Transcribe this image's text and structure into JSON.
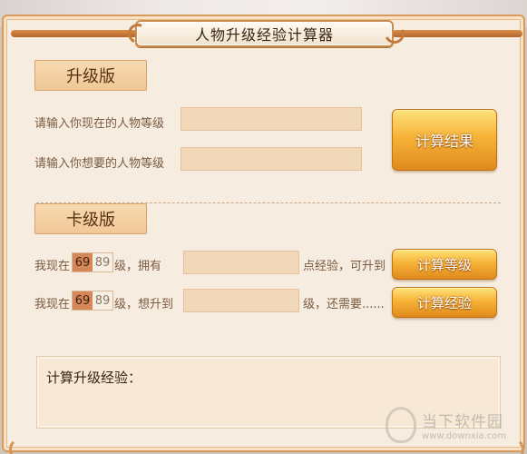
{
  "window": {
    "title": "人物升级经验计算器"
  },
  "upgrade": {
    "section_label": "升级版",
    "current_level_label": "请输入你现在的人物等级",
    "target_level_label": "请输入你想要的人物等级",
    "current_level_value": "",
    "target_level_value": "",
    "compute_button": "计算结果"
  },
  "card": {
    "section_label": "卡级版",
    "row1": {
      "prefix": "我现在",
      "current_level": "69",
      "max_level": "89",
      "suffix": "级，拥有",
      "exp_value": "",
      "after": "点经验，可升到",
      "button": "计算等级"
    },
    "row2": {
      "prefix": "我现在",
      "current_level": "69",
      "max_level": "89",
      "suffix": "级，想升到",
      "level_value": "",
      "after": "级，还需要......",
      "button": "计算经验"
    }
  },
  "result": {
    "label": "计算升级经验："
  },
  "watermark": {
    "name": "当下软件园",
    "url": "www.downxia.com"
  },
  "colors": {
    "panel_bg": "#f6ece0",
    "section_bg": "#f0c896",
    "input_bg": "#f1d8b9",
    "button_orange": "#f6b338",
    "level_highlight": "#d6875a"
  }
}
